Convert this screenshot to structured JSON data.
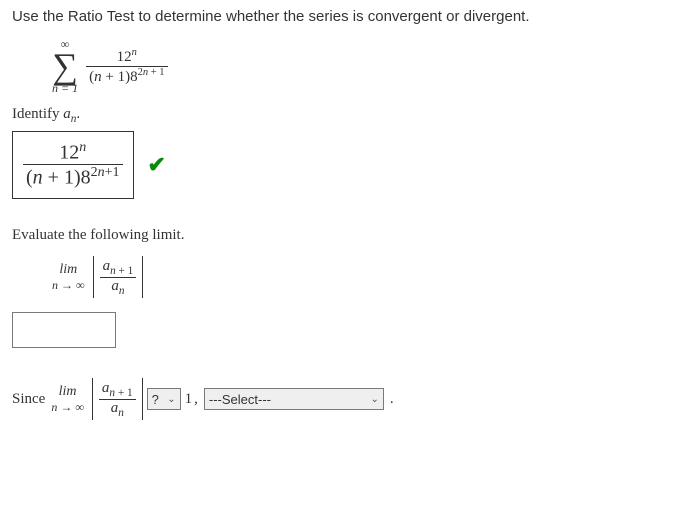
{
  "problem": {
    "instruction": "Use the Ratio Test to determine whether the series is convergent or divergent.",
    "series": {
      "sigma_top": "∞",
      "sigma_bottom_lhs": "n",
      "sigma_bottom_eq": " = 1",
      "numerator_base": "12",
      "numerator_exp": "n",
      "den_open": "(",
      "den_var": "n",
      "den_plus1": " + 1)8",
      "den_exp_a": "2",
      "den_exp_var": "n",
      "den_exp_b": " + 1"
    },
    "identify_label_a": "Identify ",
    "identify_label_b": "a",
    "identify_label_c": "n",
    "identify_label_d": "."
  },
  "answer1": {
    "num_base": "12",
    "num_exp": "n",
    "den_open": "(",
    "den_var": "n",
    "den_plus": " + 1)8",
    "den_exp_a": "2",
    "den_exp_var": "n",
    "den_exp_b": "+1"
  },
  "eval": {
    "label": "Evaluate the following limit.",
    "lim_word": "lim",
    "lim_under_var": "n",
    "lim_under_arrow": " → ∞",
    "ratio_num_a": "a",
    "ratio_num_sub": "n",
    "ratio_num_plus": " + 1",
    "ratio_den_a": "a",
    "ratio_den_sub": "n"
  },
  "since": {
    "word": "Since",
    "lim_word": "lim",
    "lim_under_var": "n",
    "lim_under_arrow": " → ∞",
    "r_num_a": "a",
    "r_num_sub": "n",
    "r_num_plus": " + 1",
    "r_den_a": "a",
    "r_den_sub": "n",
    "select1_value": "?",
    "one": "1",
    "comma": ",",
    "select2_value": "---Select---",
    "period": "."
  }
}
